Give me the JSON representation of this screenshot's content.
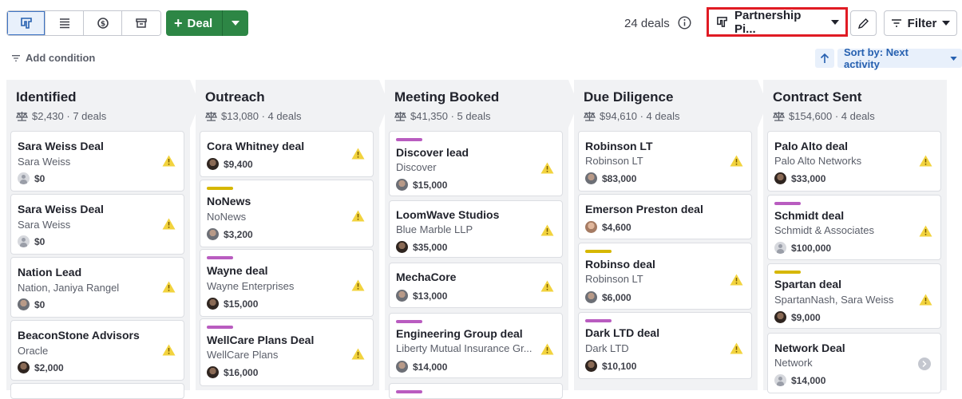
{
  "header": {
    "deal_button": "Deal",
    "deals_count": "24 deals",
    "pipeline": "Partnership Pi...",
    "filter": "Filter",
    "add_condition": "Add condition",
    "sort_by": "Sort by: Next activity"
  },
  "columns": [
    {
      "title": "Identified",
      "summary": "$2,430 · 7 deals",
      "cards": [
        {
          "name": "Sara Weiss Deal",
          "org": "Sara Weiss",
          "value": "$0"
        },
        {
          "name": "Sara Weiss Deal",
          "org": "Sara Weiss",
          "value": "$0"
        },
        {
          "name": "Nation Lead",
          "org": "Nation, Janiya Rangel",
          "value": "$0"
        },
        {
          "name": "BeaconStone Advisors",
          "org": "Oracle",
          "value": "$2,000"
        }
      ]
    },
    {
      "title": "Outreach",
      "summary": "$13,080 · 4 deals",
      "cards": [
        {
          "name": "Cora Whitney deal",
          "org": "",
          "value": "$9,400"
        },
        {
          "name": "NoNews",
          "org": "NoNews",
          "value": "$3,200"
        },
        {
          "name": "Wayne deal",
          "org": "Wayne Enterprises",
          "value": "$15,000"
        },
        {
          "name": "WellCare Plans Deal",
          "org": "WellCare Plans",
          "value": "$16,000"
        }
      ]
    },
    {
      "title": "Meeting Booked",
      "summary": "$41,350 · 5 deals",
      "cards": [
        {
          "name": "Discover lead",
          "org": "Discover",
          "value": "$15,000"
        },
        {
          "name": "LoomWave Studios",
          "org": "Blue Marble LLP",
          "value": "$35,000"
        },
        {
          "name": "MechaCore",
          "org": "",
          "value": "$13,000"
        },
        {
          "name": "Engineering Group deal",
          "org": "Liberty Mutual Insurance Gr...",
          "value": "$14,000"
        }
      ]
    },
    {
      "title": "Due Diligence",
      "summary": "$94,610 · 4 deals",
      "cards": [
        {
          "name": "Robinson LT",
          "org": "Robinson LT",
          "value": "$83,000"
        },
        {
          "name": "Emerson Preston deal",
          "org": "",
          "value": "$4,600"
        },
        {
          "name": "Robinso deal",
          "org": "Robinson LT",
          "value": "$6,000"
        },
        {
          "name": "Dark LTD deal",
          "org": "Dark LTD",
          "value": "$10,100"
        }
      ]
    },
    {
      "title": "Contract Sent",
      "summary": "$154,600 · 4 deals",
      "cards": [
        {
          "name": "Palo Alto deal",
          "org": "Palo Alto Networks",
          "value": "$33,000"
        },
        {
          "name": "Schmidt deal",
          "org": "Schmidt & Associates",
          "value": "$100,000"
        },
        {
          "name": "Spartan deal",
          "org": "SpartanNash, Sara Weiss",
          "value": "$9,000"
        },
        {
          "name": "Network Deal",
          "org": "Network",
          "value": "$14,000"
        }
      ]
    }
  ],
  "colors": {
    "purple_tag": "#b95cc0",
    "yellow_tag": "#d6b700",
    "warning": "#f2d33e",
    "green": "#2d8645",
    "accent": "#2660b0"
  }
}
